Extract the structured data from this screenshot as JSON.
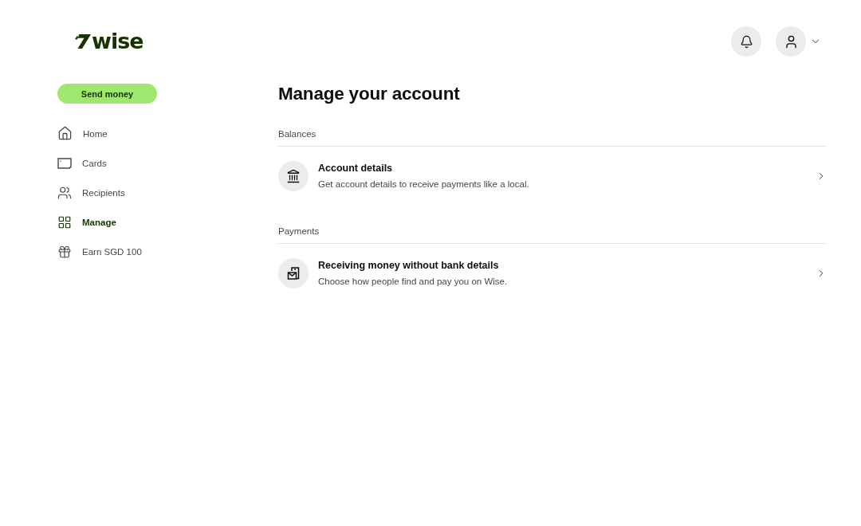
{
  "logo": "wise",
  "sidebar": {
    "primary_button": "Send money",
    "items": [
      {
        "label": "Home",
        "selected": false
      },
      {
        "label": "Cards",
        "selected": false
      },
      {
        "label": "Recipients",
        "selected": false
      },
      {
        "label": "Manage",
        "selected": true
      },
      {
        "label": "Earn SGD 100",
        "selected": false
      }
    ]
  },
  "main": {
    "title": "Manage your account",
    "sections": [
      {
        "heading": "Balances",
        "items": [
          {
            "title": "Account details",
            "description": "Get account details to receive payments like a local."
          }
        ]
      },
      {
        "heading": "Payments",
        "items": [
          {
            "title": "Receiving money without bank details",
            "description": "Choose how people find and pay you on Wise."
          }
        ]
      }
    ]
  }
}
